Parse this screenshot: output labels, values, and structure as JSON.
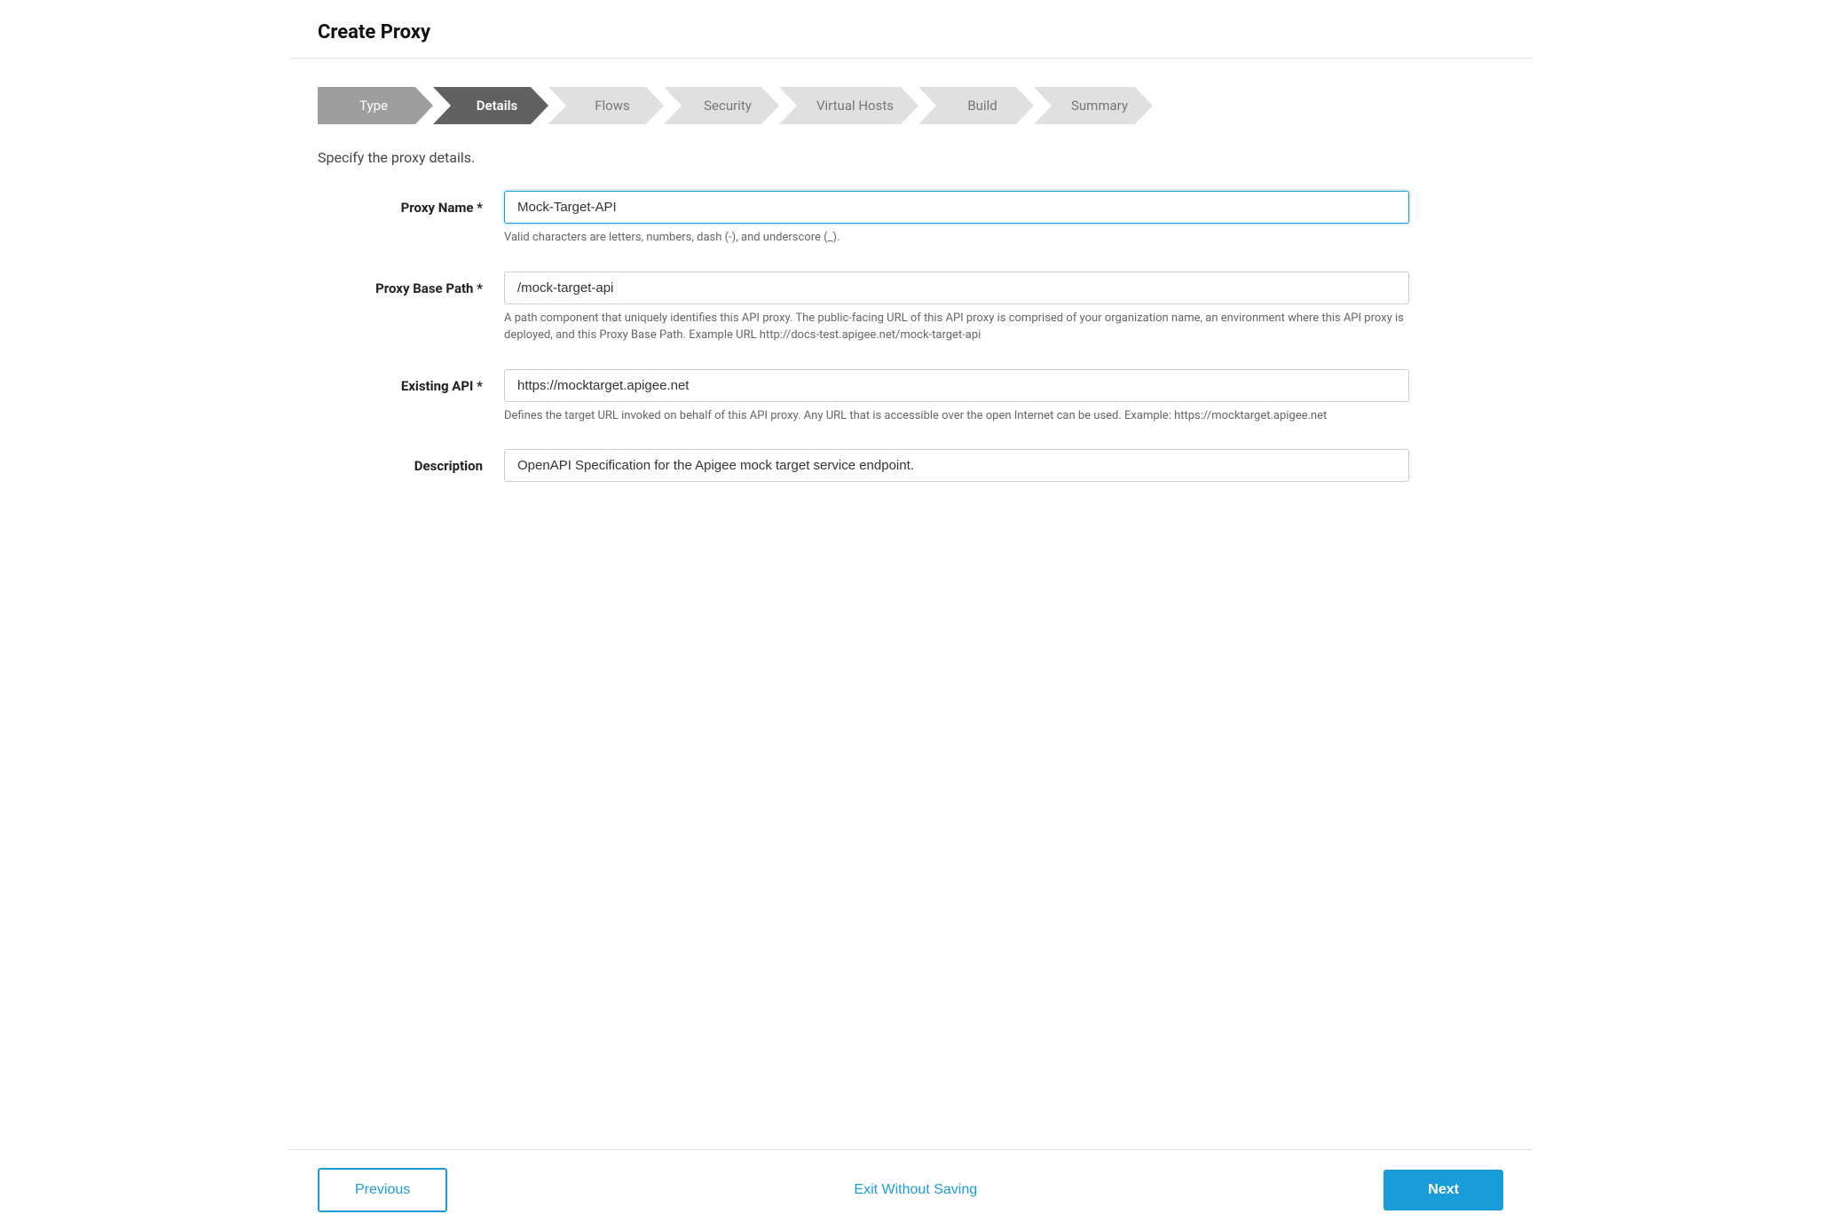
{
  "page": {
    "title": "Create Proxy"
  },
  "stepper": {
    "steps": [
      {
        "label": "Type",
        "state": "completed"
      },
      {
        "label": "Details",
        "state": "active"
      },
      {
        "label": "Flows",
        "state": "inactive"
      },
      {
        "label": "Security",
        "state": "inactive"
      },
      {
        "label": "Virtual Hosts",
        "state": "inactive"
      },
      {
        "label": "Build",
        "state": "inactive"
      },
      {
        "label": "Summary",
        "state": "inactive"
      }
    ]
  },
  "form": {
    "subtitle": "Specify the proxy details.",
    "fields": {
      "proxy_name": {
        "label": "Proxy Name",
        "required": true,
        "value": "Mock-Target-API",
        "hint": "Valid characters are letters, numbers, dash (-), and underscore (_)."
      },
      "proxy_base_path": {
        "label": "Proxy Base Path",
        "required": true,
        "value": "/mock-target-api",
        "hint": "A path component that uniquely identifies this API proxy. The public-facing URL of this API proxy is comprised of your organization name, an environment where this API proxy is deployed, and this Proxy Base Path. Example URL http://docs-test.apigee.net/mock-target-api"
      },
      "existing_api": {
        "label": "Existing API",
        "required": true,
        "value": "https://mocktarget.apigee.net",
        "hint": "Defines the target URL invoked on behalf of this API proxy. Any URL that is accessible over the open Internet can be used. Example: https://mocktarget.apigee.net"
      },
      "description": {
        "label": "Description",
        "required": false,
        "value": "OpenAPI Specification for the Apigee mock target service endpoint.",
        "hint": ""
      }
    }
  },
  "footer": {
    "previous_label": "Previous",
    "exit_label": "Exit Without Saving",
    "next_label": "Next"
  }
}
